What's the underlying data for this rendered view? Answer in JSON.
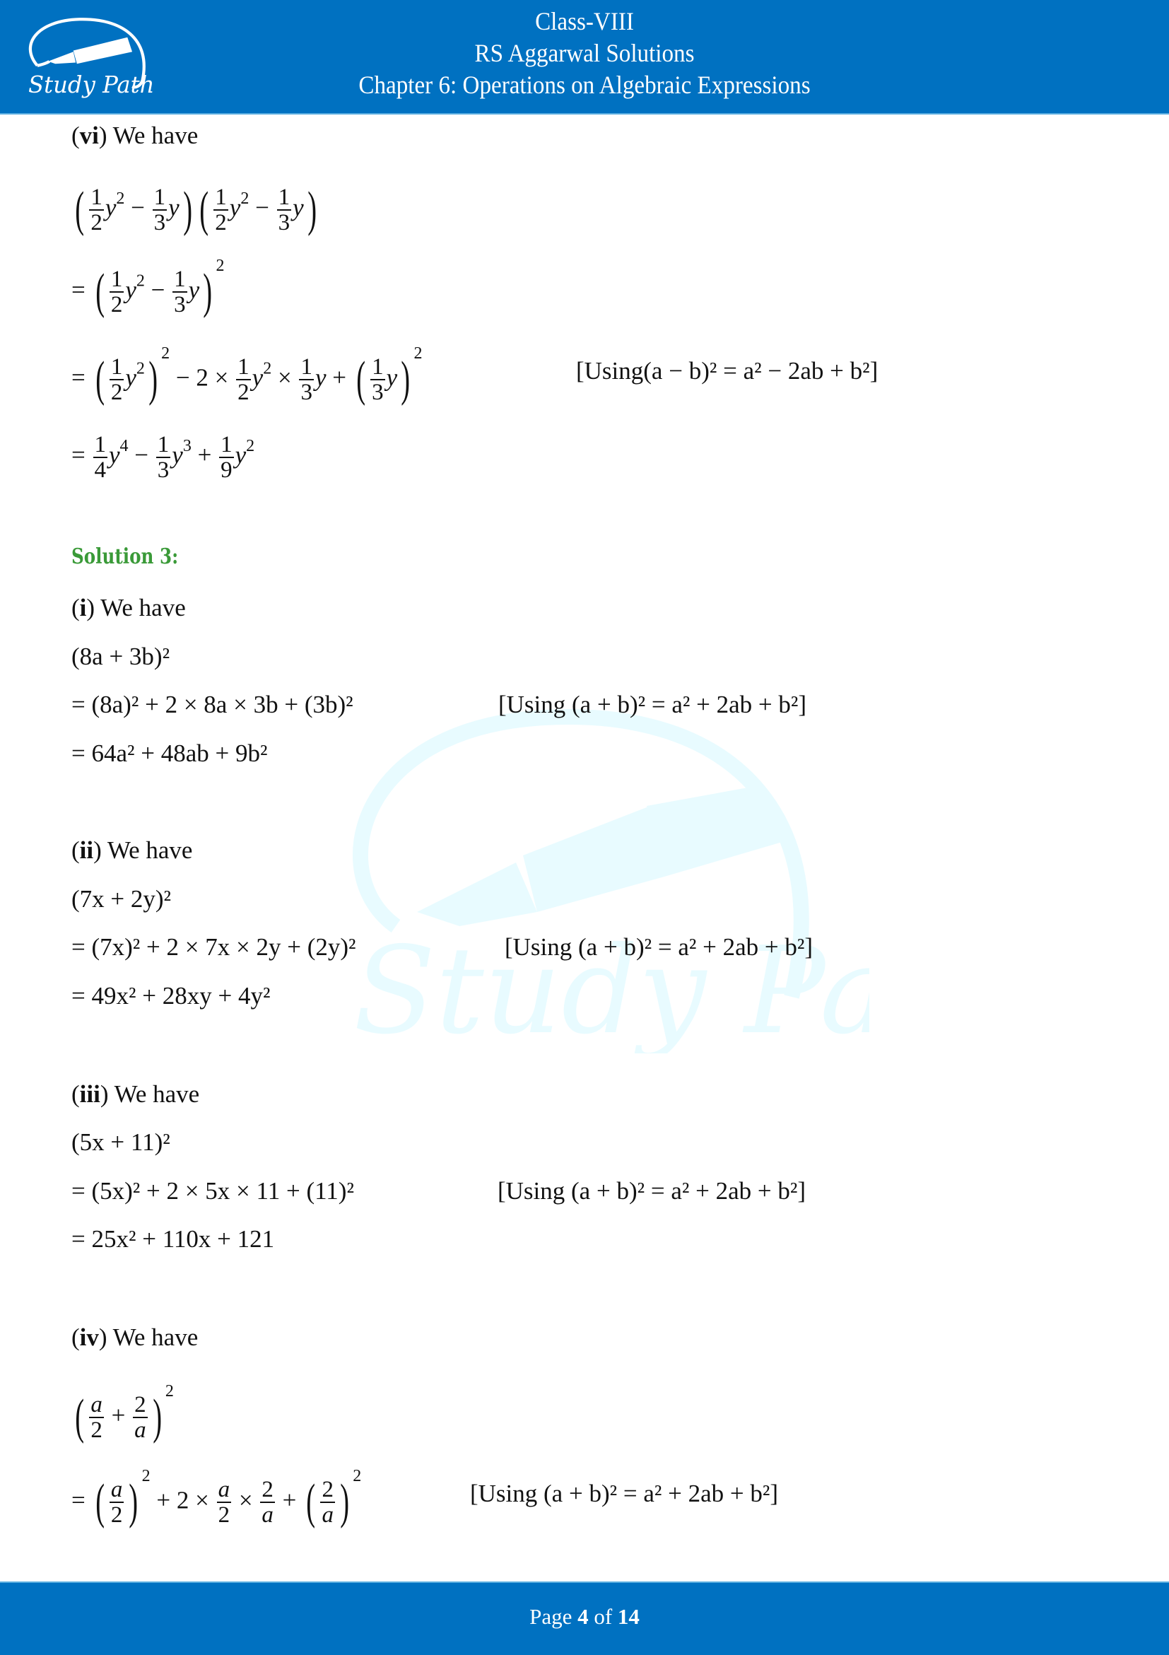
{
  "header": {
    "class": "Class-VIII",
    "book": "RS Aggarwal Solutions",
    "chapter": "Chapter 6: Operations on Algebraic Expressions",
    "logo_text": "Study Path"
  },
  "colors": {
    "band": "#0071c1",
    "heading": "#3a9a38",
    "watermark": "#e8fbff"
  },
  "part_vi": {
    "label": "vi",
    "intro": " We have",
    "line1_frac_a": {
      "num": "1",
      "den": "2"
    },
    "line1_frac_b": {
      "num": "1",
      "den": "3"
    },
    "var": "y",
    "exp2": "2",
    "exp3": "3",
    "exp4": "4",
    "minus": " − ",
    "plus": " + ",
    "eq": "= ",
    "times": " × ",
    "two": "2",
    "identity": "[Using(a − b)² = a² − 2ab + b²]",
    "result_fracs": [
      {
        "num": "1",
        "den": "4"
      },
      {
        "num": "1",
        "den": "3"
      },
      {
        "num": "1",
        "den": "9"
      }
    ]
  },
  "solution_heading": "Solution 3:",
  "parts": [
    {
      "label": "i",
      "intro": " We have",
      "expr": "(8a + 3b)²",
      "step": "= (8a)² + 2 × 8a × 3b + (3b)²",
      "identity": "[Using (a + b)² = a² + 2ab + b²]",
      "result": "= 64a² + 48ab + 9b²"
    },
    {
      "label": "ii",
      "intro": " We have",
      "expr": " (7x + 2y)²",
      "step": "= (7x)² + 2 × 7x × 2y + (2y)²",
      "identity": "[Using (a + b)² = a² + 2ab + b²]",
      "result": "= 49x² + 28xy + 4y²"
    },
    {
      "label": "iii",
      "intro": " We have",
      "expr": " (5x + 11)²",
      "step": "= (5x)² + 2 × 5x × 11 + (11)²",
      "identity": "[Using (a + b)² = a² + 2ab + b²]",
      "result": "= 25x² + 110x + 121"
    },
    {
      "label": "iv",
      "intro": " We have",
      "frac_a": {
        "num": "a",
        "den": "2"
      },
      "frac_b": {
        "num": "2",
        "den": "a"
      },
      "identity": "[Using (a + b)² = a² + 2ab + b²]"
    }
  ],
  "footer": {
    "prefix": "Page ",
    "current": "4",
    "mid": " of ",
    "total": "14"
  }
}
